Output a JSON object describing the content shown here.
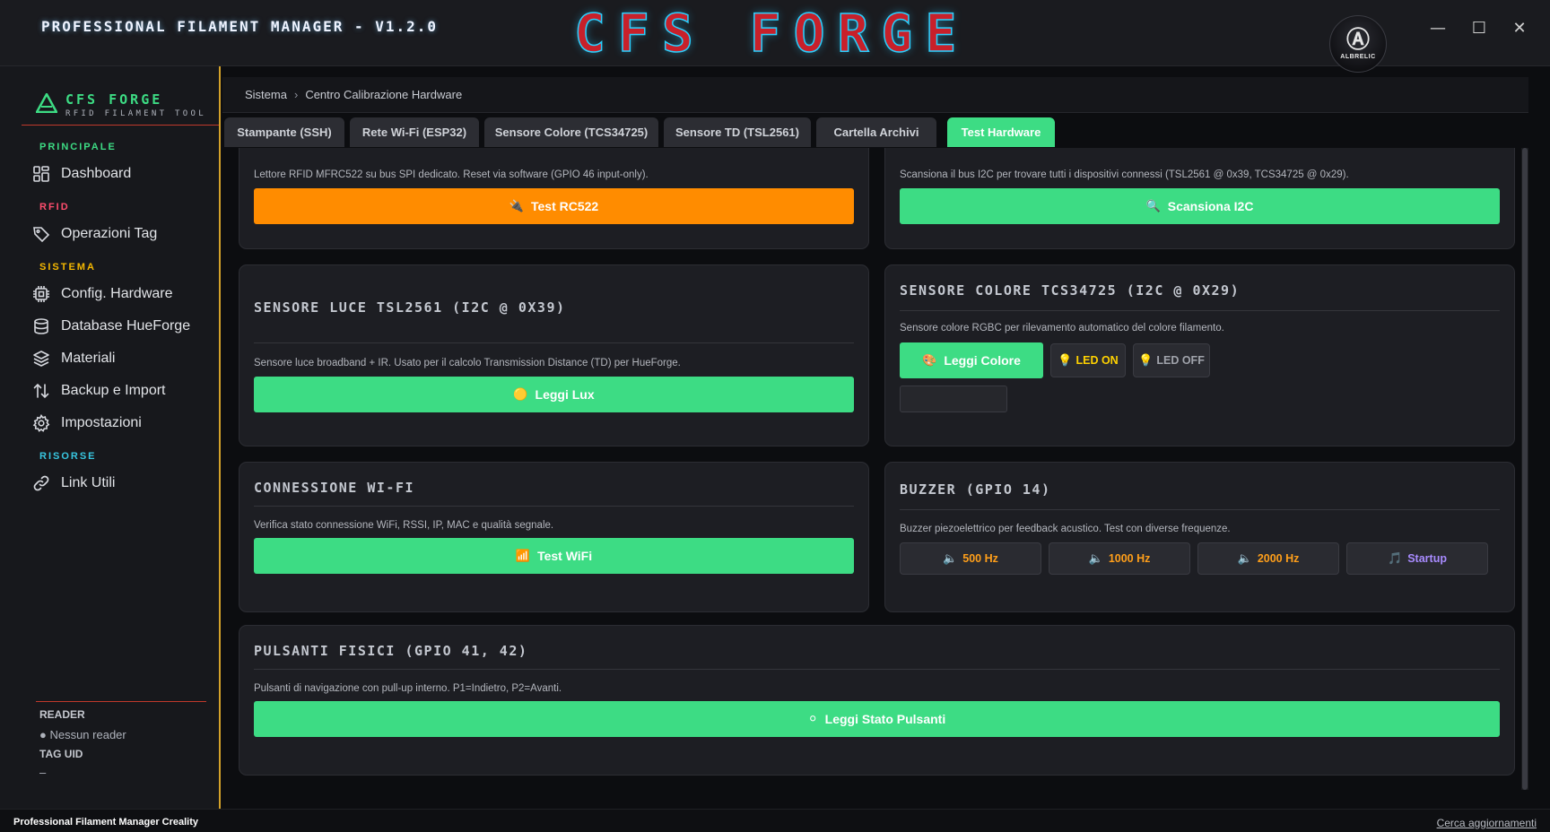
{
  "window": {
    "app_title": "PROFESSIONAL FILAMENT MANAGER - V1.2.0",
    "logo_text": "CFS FORGE",
    "avatar_label": "ALBRELIC",
    "minimize": "—",
    "maximize": "☐",
    "close": "✕"
  },
  "sidebar": {
    "brand_name": "CFS FORGE",
    "brand_sub": "RFID FILAMENT TOOL",
    "sections": {
      "principale": "PRINCIPALE",
      "rfid": "RFID",
      "sistema": "SISTEMA",
      "risorse": "RISORSE"
    },
    "items": {
      "dashboard": "Dashboard",
      "operazioni_tag": "Operazioni Tag",
      "config_hardware": "Config. Hardware",
      "database_hueforge": "Database HueForge",
      "materiali": "Materiali",
      "backup_import": "Backup e Import",
      "impostazioni": "Impostazioni",
      "link_utili": "Link Utili"
    },
    "reader_label": "READER",
    "reader_value": "● Nessun reader",
    "tag_uid_label": "TAG UID",
    "tag_uid_value": "–"
  },
  "breadcrumb": {
    "root": "Sistema",
    "separator": "›",
    "current": "Centro Calibrazione Hardware"
  },
  "tabs": [
    "Stampante (SSH)",
    "Rete Wi-Fi (ESP32)",
    "Sensore Colore (TCS34725)",
    "Sensore TD (TSL2561)",
    "Cartella Archivi",
    "Test Hardware"
  ],
  "cards": {
    "rc522": {
      "desc": "Lettore RFID MFRC522 su bus SPI dedicato. Reset via software (GPIO 46 input-only).",
      "button": "Test RC522",
      "button_icon": "🔌"
    },
    "i2c": {
      "desc": "Scansiona il bus I2C per trovare tutti i dispositivi connessi (TSL2561 @ 0x39, TCS34725 @ 0x29).",
      "button": "Scansiona I2C",
      "button_icon": "🔍"
    },
    "tsl": {
      "title": "SENSORE LUCE TSL2561 (I2C @ 0X39)",
      "desc": "Sensore luce broadband + IR. Usato per il calcolo Transmission Distance (TD) per HueForge.",
      "button": "Leggi Lux",
      "button_icon": "🟡"
    },
    "tcs": {
      "title": "SENSORE COLORE TCS34725 (I2C @ 0X29)",
      "desc": "Sensore colore RGBC per rilevamento automatico del colore filamento.",
      "button": "Leggi Colore",
      "button_icon": "🎨",
      "led_on": "LED ON",
      "led_off": "LED OFF",
      "led_icon": "💡"
    },
    "wifi": {
      "title": "CONNESSIONE WI-FI",
      "desc": "Verifica stato connessione WiFi, RSSI, IP, MAC e qualità segnale.",
      "button": "Test WiFi",
      "button_icon": "📶"
    },
    "buzzer": {
      "title": "BUZZER (GPIO 14)",
      "desc": "Buzzer piezoelettrico per feedback acustico. Test con diverse frequenze.",
      "speaker_icon": "🔈",
      "music_icon": "🎵",
      "b500": "500 Hz",
      "b1000": "1000 Hz",
      "b2000": "2000 Hz",
      "startup": "Startup"
    },
    "buttons": {
      "title": "PULSANTI FISICI (GPIO 41, 42)",
      "desc": "Pulsanti di navigazione con pull-up interno. P1=Indietro, P2=Avanti.",
      "button": "Leggi Stato Pulsanti",
      "button_icon": "⚪"
    }
  },
  "statusbar": {
    "left": "Professional Filament Manager Creality",
    "right": "Cerca aggiornamenti"
  },
  "colors": {
    "accent_green": "#3ddc84",
    "accent_orange": "#ff8c00",
    "section_principale": "#3ddc84",
    "section_rfid": "#ff4d6d",
    "section_sistema": "#f5b800",
    "section_risorse": "#38c6e0",
    "buzzer_label": "#ff9f1a",
    "startup_label": "#a88bff",
    "led_on_label": "#ffd200",
    "led_off_label": "#a0a3ab"
  }
}
